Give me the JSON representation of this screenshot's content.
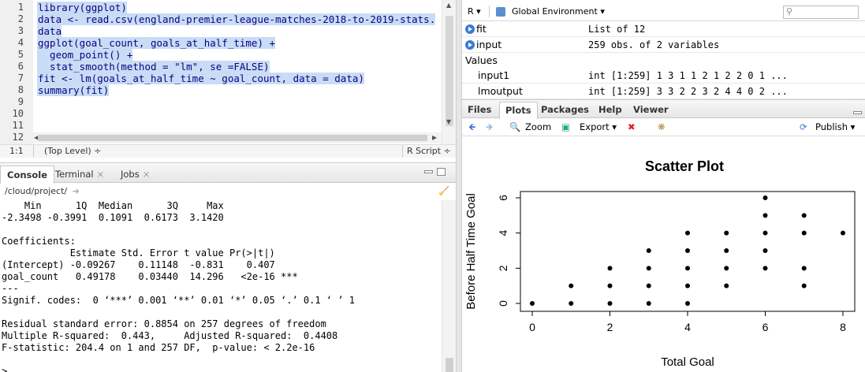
{
  "editor": {
    "lines": [
      {
        "num": "1",
        "code": "library(ggplot)"
      },
      {
        "num": "2",
        "code": "data <- read.csv(england-premier-league-matches-2018-to-2019-stats."
      },
      {
        "num": "3",
        "code": "data"
      },
      {
        "num": "4",
        "code": "ggplot(goal_count, goals_at_half_time) +"
      },
      {
        "num": "5",
        "code": "  geom_point() +"
      },
      {
        "num": "6",
        "code": "  stat_smooth(method = \"lm\", se =FALSE)"
      },
      {
        "num": "7",
        "code": "fit <- lm(goals_at_half_time ~ goal_count, data = data)"
      },
      {
        "num": "8",
        "code": "summary(fit)"
      },
      {
        "num": "9",
        "code": ""
      },
      {
        "num": "10",
        "code": ""
      },
      {
        "num": "11",
        "code": ""
      },
      {
        "num": "12",
        "code": ""
      }
    ],
    "status_position": "1:1",
    "status_scope": "(Top Level) ÷",
    "status_type": "R Script ÷"
  },
  "console": {
    "tabs": {
      "console": "Console",
      "terminal": "Terminal",
      "jobs": "Jobs"
    },
    "path": "/cloud/project/",
    "output": "    Min      1Q  Median      3Q     Max \n-2.3498 -0.3991  0.1091  0.6173  3.1420 \n\nCoefficients:\n            Estimate Std. Error t value Pr(>|t|)    \n(Intercept) -0.09267    0.11148  -0.831    0.407    \ngoal_count   0.49178    0.03440  14.296   <2e-16 ***\n---\nSignif. codes:  0 ‘***’ 0.001 ‘**’ 0.01 ‘*’ 0.05 ‘.’ 0.1 ‘ ’ 1\n\nResidual standard error: 0.8854 on 257 degrees of freedom\nMultiple R-squared:  0.443,\tAdjusted R-squared:  0.4408 \nF-statistic: 204.4 on 1 and 257 DF,  p-value: < 2.2e-16\n\n>"
  },
  "environment": {
    "r_label": "R ▾",
    "scope": "Global Environment ▾",
    "search_placeholder": "",
    "rows": [
      {
        "name": "fit",
        "value": "List of  12"
      },
      {
        "name": "input",
        "value": "259 obs. of 2 variables"
      }
    ],
    "values_header": "Values",
    "values": [
      {
        "name": "input1",
        "value": "int [1:259] 1 3 1 1 2 1 2 2 0 1 ..."
      },
      {
        "name": "lmoutput",
        "value": "int [1:259] 3 3 2 2 3 2 4 4 0 2 ..."
      }
    ]
  },
  "plots": {
    "tabs": [
      "Files",
      "Plots",
      "Packages",
      "Help",
      "Viewer"
    ],
    "active_tab": "Plots",
    "toolbar": {
      "zoom": "Zoom",
      "export": "Export ▾",
      "publish": "Publish ▾"
    }
  },
  "chart_data": {
    "type": "scatter",
    "title": "Scatter Plot",
    "xlabel": "Total Goal",
    "ylabel": "Before Half Time Goal",
    "xlim": [
      0,
      8
    ],
    "ylim": [
      0,
      6
    ],
    "xticks": [
      "0",
      "2",
      "4",
      "6",
      "8"
    ],
    "yticks": [
      "0",
      "2",
      "4",
      "6"
    ],
    "points": [
      [
        0,
        0
      ],
      [
        1,
        0
      ],
      [
        1,
        1
      ],
      [
        2,
        0
      ],
      [
        2,
        1
      ],
      [
        2,
        2
      ],
      [
        3,
        0
      ],
      [
        3,
        1
      ],
      [
        3,
        2
      ],
      [
        3,
        3
      ],
      [
        4,
        0
      ],
      [
        4,
        1
      ],
      [
        4,
        2
      ],
      [
        4,
        3
      ],
      [
        4,
        4
      ],
      [
        5,
        1
      ],
      [
        5,
        2
      ],
      [
        5,
        3
      ],
      [
        5,
        4
      ],
      [
        6,
        2
      ],
      [
        6,
        3
      ],
      [
        6,
        4
      ],
      [
        6,
        5
      ],
      [
        6,
        6
      ],
      [
        7,
        1
      ],
      [
        7,
        2
      ],
      [
        7,
        4
      ],
      [
        7,
        5
      ],
      [
        8,
        4
      ]
    ],
    "colors": {
      "point": "#000000"
    }
  }
}
